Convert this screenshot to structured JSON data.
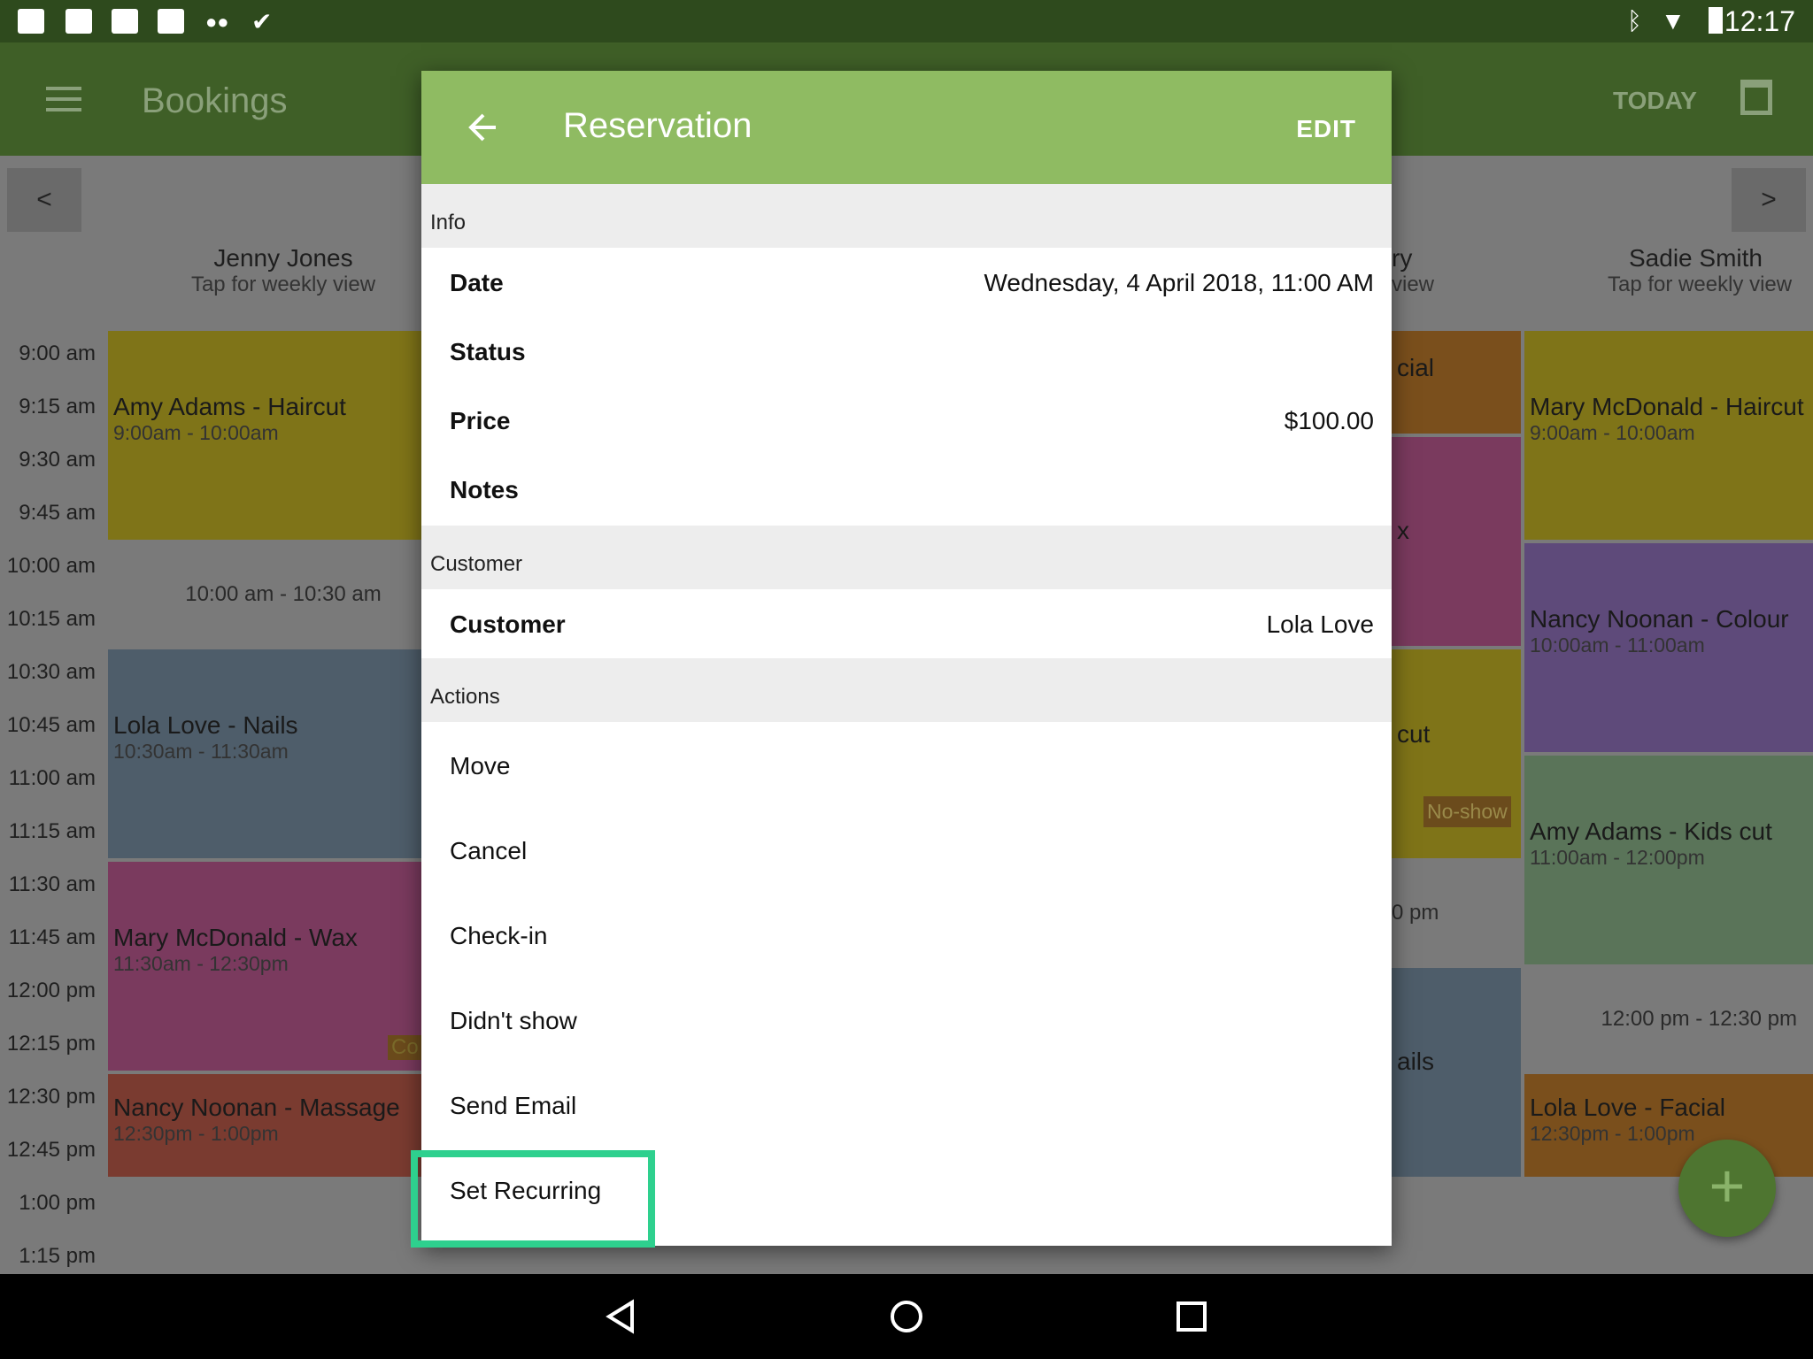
{
  "status_bar": {
    "time": "12:17"
  },
  "app_bar": {
    "title": "Bookings",
    "today_label": "TODAY"
  },
  "calendar": {
    "prev_label": "<",
    "next_label": ">",
    "columns": [
      {
        "name": "Jenny Jones",
        "sub": "Tap for weekly view"
      },
      {
        "name": "ry",
        "sub": "view"
      },
      {
        "name": "Sadie Smith",
        "sub": "Tap for weekly view"
      }
    ],
    "times": [
      "9:00 am",
      "9:15 am",
      "9:30 am",
      "9:45 am",
      "10:00 am",
      "10:15 am",
      "10:30 am",
      "10:45 am",
      "11:00 am",
      "11:15 am",
      "11:30 am",
      "11:45 am",
      "12:00 pm",
      "12:15 pm",
      "12:30 pm",
      "12:45 pm",
      "1:00 pm",
      "1:15 pm"
    ],
    "appointments": [
      {
        "title": "Amy Adams - Haircut",
        "time": "9:00am - 10:00am"
      },
      {
        "title": "Lola Love - Nails",
        "time": "10:30am - 11:30am"
      },
      {
        "title": "Mary McDonald - Wax",
        "time": "11:30am - 12:30pm"
      },
      {
        "title": "Nancy Noonan - Massage",
        "time": "12:30pm - 1:00pm"
      },
      {
        "title": "Mary McDonald - Haircut",
        "time": "9:00am - 10:00am"
      },
      {
        "title": "Nancy Noonan - Colour",
        "time": "10:00am - 11:00am"
      },
      {
        "title": "Amy Adams - Kids cut",
        "time": "11:00am - 12:00pm"
      },
      {
        "title": "Lola Love - Facial",
        "time": "12:30pm - 1:00pm"
      },
      {
        "title": "cial",
        "time": ""
      },
      {
        "title": "x",
        "time": ""
      },
      {
        "title": "cut",
        "time": ""
      },
      {
        "title": "ails",
        "time": ""
      }
    ],
    "free_slots": [
      "10:00 am - 10:30 am",
      "12:00 pm - 12:30 pm",
      "0 pm"
    ],
    "badge_noshow": "No-show",
    "badge_co": "Co",
    "colors": {
      "yellow": "#7f7418",
      "blue": "#4e5d6a",
      "pink": "#7a3a5e",
      "red": "#7a3b30",
      "orange": "#7a4f1c",
      "purple": "#5e4a7a",
      "green": "#5a7459"
    }
  },
  "dialog": {
    "title": "Reservation",
    "edit_label": "EDIT",
    "info_section": "Info",
    "fields": {
      "date_label": "Date",
      "date_value": "Wednesday, 4 April 2018, 11:00 AM",
      "status_label": "Status",
      "price_label": "Price",
      "price_value": "$100.00",
      "notes_label": "Notes"
    },
    "customer_section": "Customer",
    "customer_label": "Customer",
    "customer_value": "Lola Love",
    "actions_section": "Actions",
    "actions": [
      "Move",
      "Cancel",
      "Check-in",
      "Didn't show",
      "Send Email",
      "Set Recurring"
    ],
    "header_color": "#8fbb62",
    "highlight_color": "#2ed08e"
  },
  "fab": {
    "icon": "plus-icon"
  }
}
